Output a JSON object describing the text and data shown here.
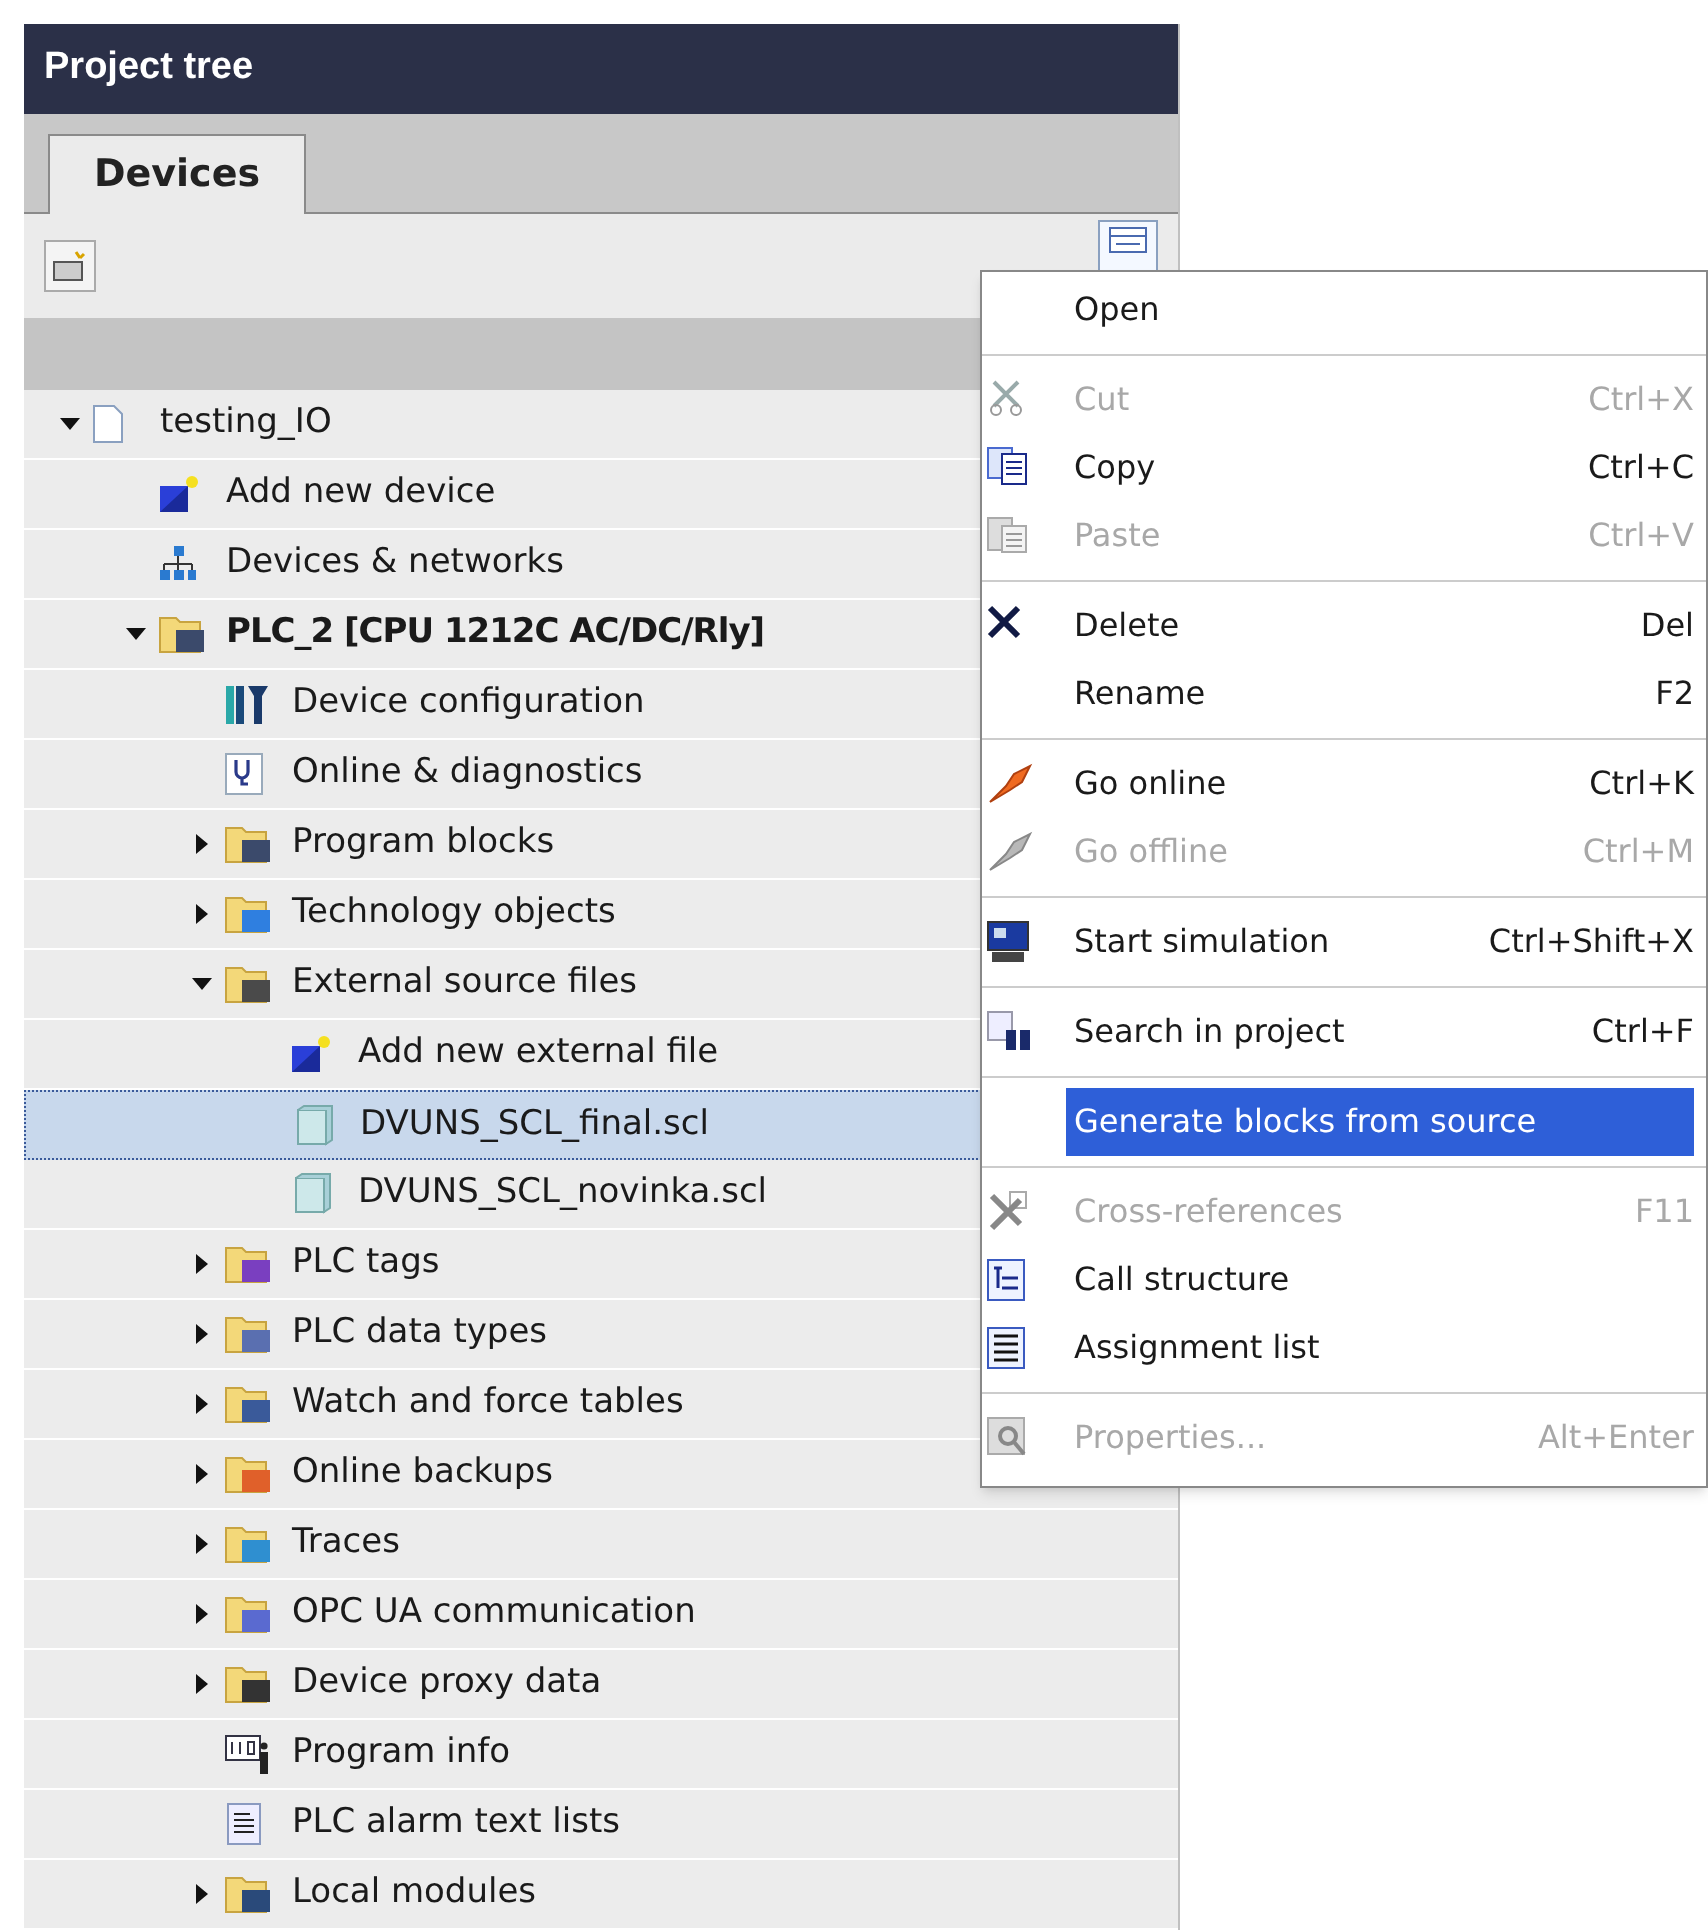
{
  "panel": {
    "title": "Project tree"
  },
  "tabs": [
    {
      "label": "Devices",
      "selected": true
    }
  ],
  "tree": [
    {
      "label": "testing_IO",
      "expanded": true,
      "selected": false,
      "children": [
        {
          "label": "Add new device",
          "selected": false
        },
        {
          "label": "Devices & networks",
          "selected": false
        },
        {
          "label": "PLC_2 [CPU 1212C AC/DC/Rly]",
          "expanded": true,
          "selected": false,
          "bold": true,
          "children": [
            {
              "label": "Device configuration",
              "selected": false
            },
            {
              "label": "Online & diagnostics",
              "selected": false
            },
            {
              "label": "Program blocks",
              "expanded": false,
              "selected": false
            },
            {
              "label": "Technology objects",
              "expanded": false,
              "selected": false
            },
            {
              "label": "External source files",
              "expanded": true,
              "selected": false,
              "children": [
                {
                  "label": "Add new external file",
                  "selected": false
                },
                {
                  "label": "DVUNS_SCL_final.scl",
                  "selected": true
                },
                {
                  "label": "DVUNS_SCL_novinka.scl",
                  "selected": false
                }
              ]
            },
            {
              "label": "PLC tags",
              "expanded": false,
              "selected": false
            },
            {
              "label": "PLC data types",
              "expanded": false,
              "selected": false
            },
            {
              "label": "Watch and force tables",
              "expanded": false,
              "selected": false
            },
            {
              "label": "Online backups",
              "expanded": false,
              "selected": false
            },
            {
              "label": "Traces",
              "expanded": false,
              "selected": false
            },
            {
              "label": "OPC UA communication",
              "expanded": false,
              "selected": false
            },
            {
              "label": "Device proxy data",
              "expanded": false,
              "selected": false
            },
            {
              "label": "Program info",
              "selected": false
            },
            {
              "label": "PLC alarm text lists",
              "selected": false
            },
            {
              "label": "Local modules",
              "expanded": false,
              "selected": false
            }
          ]
        }
      ]
    }
  ],
  "context_menu": {
    "groups": [
      [
        {
          "label": "Open",
          "disabled": false,
          "selected": false
        }
      ],
      [
        {
          "label": "Cut",
          "shortcut": "Ctrl+X",
          "disabled": true,
          "selected": false
        },
        {
          "label": "Copy",
          "shortcut": "Ctrl+C",
          "disabled": false,
          "selected": false
        },
        {
          "label": "Paste",
          "shortcut": "Ctrl+V",
          "disabled": true,
          "selected": false
        }
      ],
      [
        {
          "label": "Delete",
          "shortcut": "Del",
          "disabled": false,
          "selected": false
        },
        {
          "label": "Rename",
          "shortcut": "F2",
          "disabled": false,
          "selected": false
        }
      ],
      [
        {
          "label": "Go online",
          "shortcut": "Ctrl+K",
          "disabled": false,
          "selected": false
        },
        {
          "label": "Go offline",
          "shortcut": "Ctrl+M",
          "disabled": true,
          "selected": false
        }
      ],
      [
        {
          "label": "Start simulation",
          "shortcut": "Ctrl+Shift+X",
          "disabled": false,
          "selected": false
        }
      ],
      [
        {
          "label": "Search in project",
          "shortcut": "Ctrl+F",
          "disabled": false,
          "selected": false
        }
      ],
      [
        {
          "label": "Generate blocks from source",
          "disabled": false,
          "selected": true
        }
      ],
      [
        {
          "label": "Cross-references",
          "shortcut": "F11",
          "disabled": true,
          "selected": false
        },
        {
          "label": "Call structure",
          "disabled": false,
          "selected": false
        },
        {
          "label": "Assignment list",
          "disabled": false,
          "selected": false
        }
      ],
      [
        {
          "label": "Properties...",
          "shortcut": "Alt+Enter",
          "disabled": true,
          "selected": false
        }
      ]
    ]
  }
}
